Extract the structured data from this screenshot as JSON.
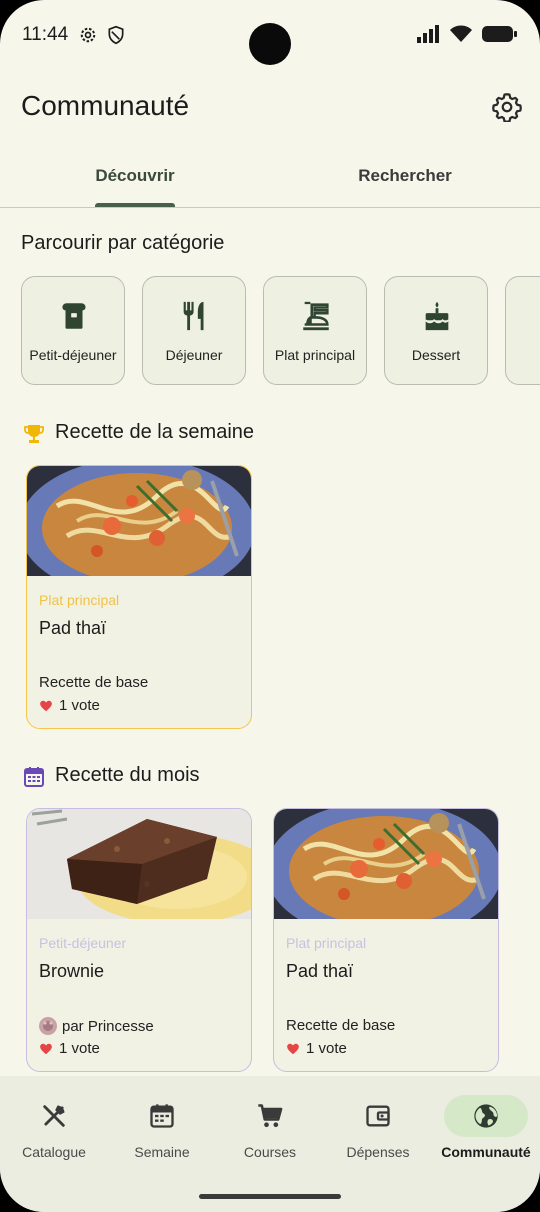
{
  "status_bar": {
    "time": "11:44"
  },
  "app_bar": {
    "title": "Communauté"
  },
  "tabs": [
    {
      "label": "Découvrir",
      "active": true
    },
    {
      "label": "Rechercher",
      "active": false
    }
  ],
  "categories": {
    "title": "Parcourir par catégorie",
    "items": [
      {
        "label": "Petit-déjeuner",
        "icon": "toast-icon"
      },
      {
        "label": "Déjeuner",
        "icon": "fork-knife-icon"
      },
      {
        "label": "Plat principal",
        "icon": "ramen-icon"
      },
      {
        "label": "Dessert",
        "icon": "cake-icon"
      }
    ]
  },
  "recipe_of_week": {
    "title": "Recette de la semaine",
    "icon": "trophy-icon",
    "accent": "#f4c74a",
    "cards": [
      {
        "category": "Plat principal",
        "name": "Pad thaï",
        "author": "Recette de base",
        "votes": "1 vote",
        "image": "pad-thai"
      }
    ]
  },
  "recipe_of_month": {
    "title": "Recette du mois",
    "icon": "calendar-icon",
    "accent": "#c7bde0",
    "cards": [
      {
        "category": "Petit-déjeuner",
        "name": "Brownie",
        "author": "par Princesse",
        "votes": "1 vote",
        "image": "brownie"
      },
      {
        "category": "Plat principal",
        "name": "Pad thaï",
        "author": "Recette de base",
        "votes": "1 vote",
        "image": "pad-thai"
      }
    ]
  },
  "bottom_nav": [
    {
      "label": "Catalogue",
      "icon": "utensils-crossed-icon",
      "active": false
    },
    {
      "label": "Semaine",
      "icon": "calendar-icon",
      "active": false
    },
    {
      "label": "Courses",
      "icon": "cart-icon",
      "active": false
    },
    {
      "label": "Dépenses",
      "icon": "wallet-icon",
      "active": false
    },
    {
      "label": "Communauté",
      "icon": "globe-icon",
      "active": true
    }
  ]
}
